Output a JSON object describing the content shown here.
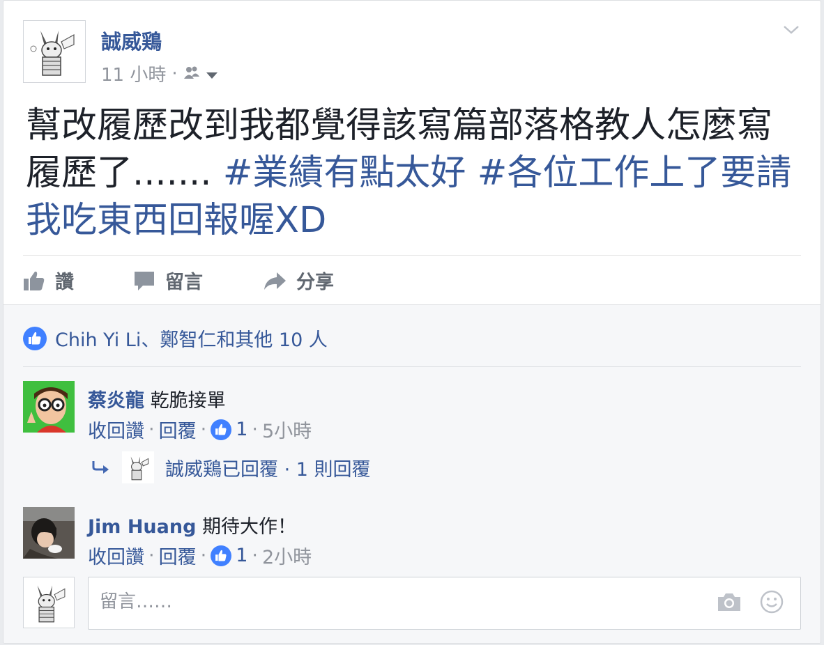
{
  "post": {
    "author": "誠威鶏",
    "time": "11 小時",
    "meta_separator": "·",
    "text_plain": "幫改履歷改到我都覺得該寫篇部落格教人怎麼寫履歷了.......",
    "hashtag_1": "#業績有點太好",
    "hashtag_2": "#各位工作上了要請我吃東西回報喔XD",
    "privacy_icon": "friends-icon",
    "options_icon": "chevron-down-icon"
  },
  "actions": {
    "like": "讚",
    "comment": "留言",
    "share": "分享"
  },
  "likes": {
    "summary": "Chih Yi Li、鄭智仁和其他 10 人"
  },
  "comments": [
    {
      "name": "蔡炎龍",
      "text": "乾脆接單",
      "unlike": "收回讚",
      "reply": "回覆",
      "like_count": "1",
      "time": "5小時",
      "sep": "·"
    },
    {
      "name": "Jim Huang",
      "text": "期待大作！",
      "unlike": "收回讚",
      "reply": "回覆",
      "like_count": "1",
      "time": "2小時",
      "sep": "·"
    }
  ],
  "reply_summary": {
    "text": "誠威鶏已回覆 · 1 則回覆"
  },
  "composer": {
    "placeholder": "留言……",
    "camera_icon": "camera-icon",
    "emoji_icon": "emoji-icon"
  },
  "colors": {
    "link": "#365899",
    "muted": "#90949c",
    "like_blue": "#4080ff"
  }
}
